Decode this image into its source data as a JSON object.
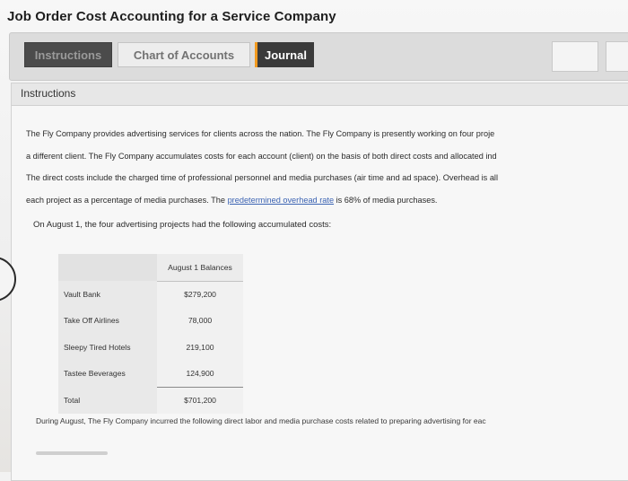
{
  "page": {
    "title": "Job Order Cost Accounting for a Service Company"
  },
  "tabs": [
    {
      "label": "Instructions"
    },
    {
      "label": "Chart of Accounts"
    },
    {
      "label": "Journal"
    }
  ],
  "section": {
    "heading": "Instructions"
  },
  "paragraph": {
    "line1": "The Fly Company provides advertising services for clients across the nation. The Fly Company is presently working on four proje",
    "line2": "a different client. The Fly Company accumulates costs for each account (client) on the basis of both direct costs and allocated ind",
    "line3": "The direct costs include the charged time of professional personnel and media purchases (air time and ad space). Overhead is all",
    "line4_before": "each project as a percentage of media purchases. The ",
    "line4_link": "predetermined overhead rate",
    "line4_after": " is 68% of media purchases."
  },
  "intro": "On August 1, the four advertising projects had the following accumulated costs:",
  "balances": {
    "header": "August 1 Balances",
    "rows": [
      {
        "name": "Vault Bank",
        "value": "$279,200"
      },
      {
        "name": "Take Off Airlines",
        "value": "78,000"
      },
      {
        "name": "Sleepy Tired Hotels",
        "value": "219,100"
      },
      {
        "name": "Tastee Beverages",
        "value": "124,900"
      }
    ],
    "total": {
      "name": "Total",
      "value": "$701,200"
    }
  },
  "footer": {
    "text": "During August, The Fly Company incurred the following direct labor and media purchase costs related to preparing advertising for eac"
  }
}
